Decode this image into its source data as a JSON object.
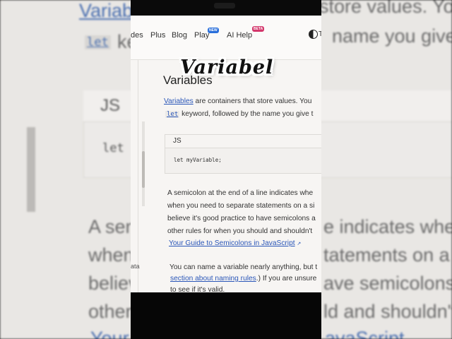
{
  "background": {
    "line1_link": "Variab",
    "line1_rest": "store values. You",
    "line2_code": "let",
    "line2_rest": "name you give t",
    "line2_ke": "ke",
    "js_label": "JS",
    "code": "let",
    "para_lines": [
      "A sem",
      "when",
      "believ",
      "other",
      "Your"
    ],
    "right_lines": [
      "e indicates whe",
      "tatements on a si",
      "ave semicolons a",
      "ld and shouldn't",
      "avaScript"
    ]
  },
  "nav": {
    "items": [
      "des",
      "Plus",
      "Blog",
      "Play",
      "AI Help"
    ],
    "play_badge": "NEW",
    "ai_badge": "BETA",
    "theme_letter": "T"
  },
  "sidebar": {
    "fragment": "ata"
  },
  "article": {
    "heading": "Variables",
    "intro_link": "Variables",
    "intro_rest": " are containers that store values. You",
    "intro_code": "let",
    "intro_line2": " keyword, followed by the name you give t",
    "code_lang": "JS",
    "code": "let myVariable;",
    "semicolon_lines": [
      "A semicolon at the end of a line indicates whe",
      "when you need to separate statements on a si",
      "believe it's good practice to have semicolons a",
      "other rules for when you should and shouldn't"
    ],
    "semicolon_link": "Your Guide to Semicolons in JavaScript",
    "naming_line1": "You can name a variable nearly anything, but t",
    "naming_link": "section about naming rules",
    "naming_line2_rest": ".) If you are unsure",
    "naming_line3": "to see if it's valid."
  },
  "caption": {
    "text": "Variabel"
  }
}
